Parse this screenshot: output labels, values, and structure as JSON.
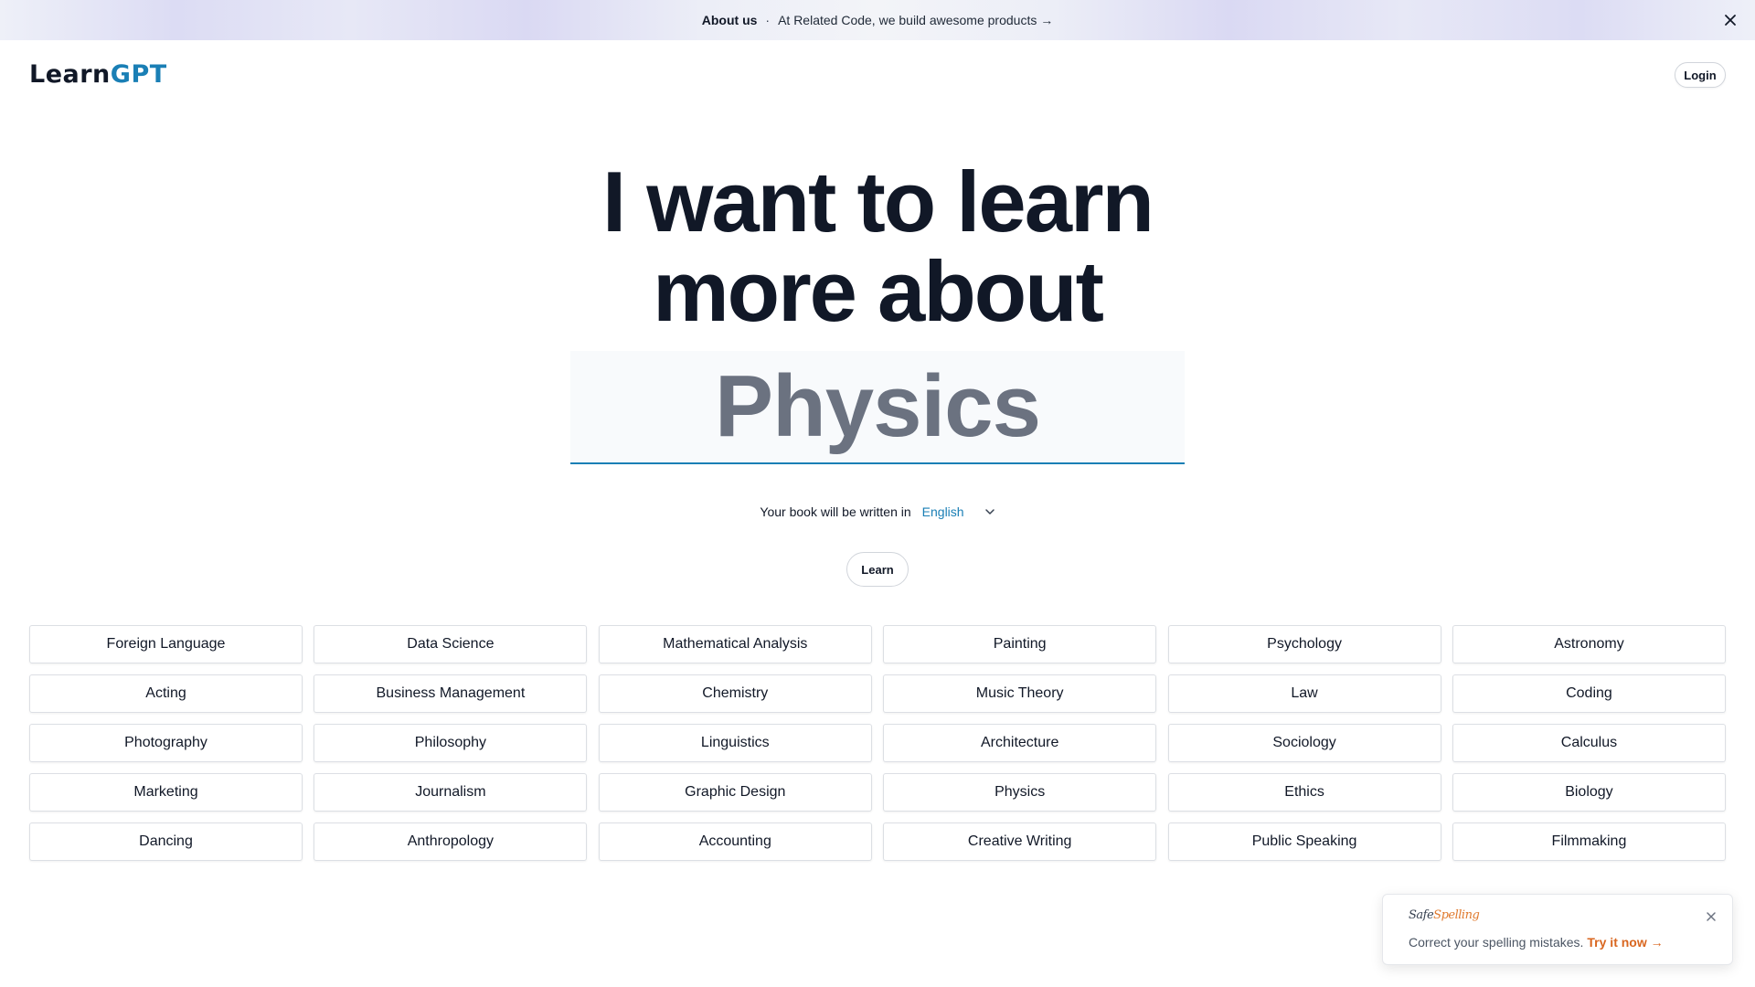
{
  "banner": {
    "about_label": "About us",
    "separator": "·",
    "message": "At Related Code, we build awesome products →",
    "close_icon": "close-icon"
  },
  "header": {
    "logo_part1": "Learn",
    "logo_part2": "GPT",
    "login_label": "Login"
  },
  "hero": {
    "headline_line1": "I want to learn",
    "headline_line2": "more about",
    "topic_value": "Physics"
  },
  "language": {
    "label": "Your book will be written in",
    "selected": "English",
    "chevron_icon": "chevron-down-icon"
  },
  "learn_button": "Learn",
  "topics": [
    "Foreign Language",
    "Data Science",
    "Mathematical Analysis",
    "Painting",
    "Psychology",
    "Astronomy",
    "Acting",
    "Business Management",
    "Chemistry",
    "Music Theory",
    "Law",
    "Coding",
    "Photography",
    "Philosophy",
    "Linguistics",
    "Architecture",
    "Sociology",
    "Calculus",
    "Marketing",
    "Journalism",
    "Graphic Design",
    "Physics",
    "Ethics",
    "Biology",
    "Dancing",
    "Anthropology",
    "Accounting",
    "Creative Writing",
    "Public Speaking",
    "Filmmaking"
  ],
  "promo": {
    "brand_part1": "Safe",
    "brand_part2": "Spelling",
    "text": "Correct your spelling mistakes.",
    "cta": "Try it now →",
    "close_icon": "close-icon"
  },
  "colors": {
    "accent": "#1a7fb5",
    "promo_accent": "#d9661f",
    "text_dark": "#111827",
    "topic_text": "#6b7280"
  }
}
